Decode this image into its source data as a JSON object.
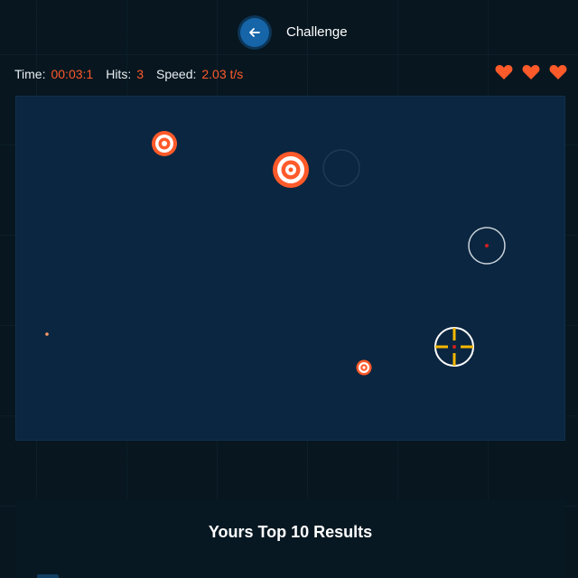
{
  "header": {
    "back_icon": "arrow-left-icon",
    "title": "Challenge"
  },
  "stats": {
    "time_label": "Time:",
    "time_value": "00:03:1",
    "hits_label": "Hits:",
    "hits_value": "3",
    "speed_label": "Speed:",
    "speed_value": "2.03 t/s"
  },
  "lives": {
    "count": 3,
    "icon": "heart-icon",
    "color": "#ff5a2a"
  },
  "colors": {
    "accent": "#ff5a2a",
    "crosshair": "#f5b800",
    "arena": "#0b2640",
    "button": "#1565a8"
  },
  "results": {
    "title": "Yours Top 10 Results"
  }
}
